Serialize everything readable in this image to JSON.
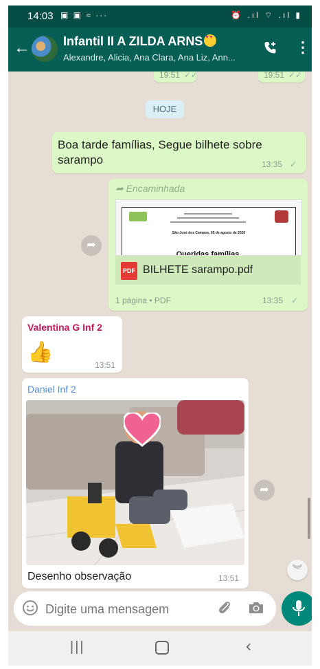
{
  "status_bar": {
    "time": "14:03",
    "left_icons": "▣ ▣ ≈ ···",
    "right_icons": "⏰ .ıl ⌔ .ıl ▮"
  },
  "app_bar": {
    "title": "Infantil II A ZILDA ARNS",
    "participants": "Alexandre, Alicia, Ana Clara, Ana Liz, Ann..."
  },
  "chat": {
    "prev_time_left": "19:51",
    "prev_time_right": "19:51",
    "date_chip": "HOJE",
    "msg1": {
      "text": "Boa tarde famílias, Segue bilhete sobre sarampo",
      "time": "13:35"
    },
    "msg2": {
      "forwarded_label": "Encaminhada",
      "doc_date_line": "São José dos Campos, 05 de agosto de 2020",
      "doc_greeting": "Queridas famílias,",
      "file_name": "BILHETE sarampo.pdf",
      "file_type_badge": "PDF",
      "file_info": "1 página • PDF",
      "time": "13:35"
    },
    "msg3": {
      "sender": "Valentina G Inf 2",
      "emoji": "👍",
      "time": "13:51"
    },
    "msg4": {
      "sender": "Daniel Inf 2",
      "caption": "Desenho observação",
      "time": "13:51"
    }
  },
  "input": {
    "placeholder": "Digite uma mensagem"
  },
  "colors": {
    "header": "#075e54",
    "status_bar": "#054d44",
    "outgoing_bubble": "#dcf8c6",
    "incoming_bubble": "#ffffff",
    "chat_bg": "#e6ddd4",
    "accent": "#00897b",
    "sender_valentina": "#c2185b",
    "sender_daniel": "#5c8fd6"
  }
}
